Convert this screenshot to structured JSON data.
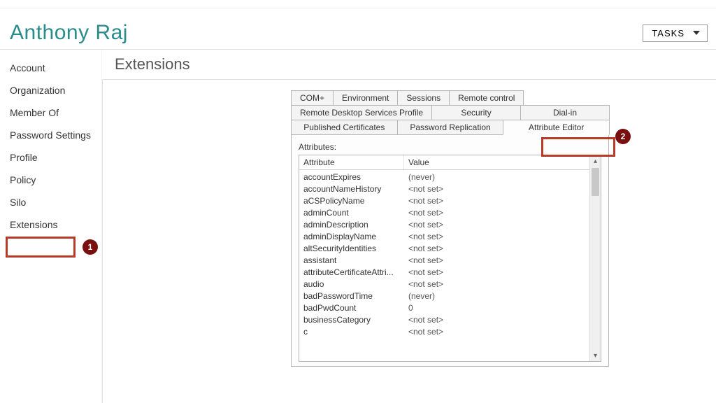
{
  "header": {
    "title": "Anthony Raj",
    "tasks_label": "TASKS"
  },
  "sidebar": {
    "items": [
      {
        "label": "Account"
      },
      {
        "label": "Organization"
      },
      {
        "label": "Member Of"
      },
      {
        "label": "Password Settings"
      },
      {
        "label": "Profile"
      },
      {
        "label": "Policy"
      },
      {
        "label": "Silo"
      },
      {
        "label": "Extensions"
      }
    ],
    "active_index": 7
  },
  "content": {
    "section_title": "Extensions"
  },
  "prop_sheet": {
    "tab_rows": [
      [
        {
          "label": "COM+"
        },
        {
          "label": "Environment"
        },
        {
          "label": "Sessions"
        },
        {
          "label": "Remote control"
        }
      ],
      [
        {
          "label": "Remote Desktop Services Profile"
        },
        {
          "label": "Security"
        },
        {
          "label": "Dial-in"
        }
      ],
      [
        {
          "label": "Published Certificates"
        },
        {
          "label": "Password Replication"
        },
        {
          "label": "Attribute Editor",
          "active": true
        }
      ]
    ],
    "attrs_label": "Attributes:",
    "columns": {
      "attr": "Attribute",
      "val": "Value"
    },
    "rows": [
      {
        "attr": "accountExpires",
        "val": "(never)"
      },
      {
        "attr": "accountNameHistory",
        "val": "<not set>"
      },
      {
        "attr": "aCSPolicyName",
        "val": "<not set>"
      },
      {
        "attr": "adminCount",
        "val": "<not set>"
      },
      {
        "attr": "adminDescription",
        "val": "<not set>"
      },
      {
        "attr": "adminDisplayName",
        "val": "<not set>"
      },
      {
        "attr": "altSecurityIdentities",
        "val": "<not set>"
      },
      {
        "attr": "assistant",
        "val": "<not set>"
      },
      {
        "attr": "attributeCertificateAttri...",
        "val": "<not set>"
      },
      {
        "attr": "audio",
        "val": "<not set>"
      },
      {
        "attr": "badPasswordTime",
        "val": "(never)"
      },
      {
        "attr": "badPwdCount",
        "val": "0"
      },
      {
        "attr": "businessCategory",
        "val": "<not set>"
      },
      {
        "attr": "c",
        "val": "<not set>"
      }
    ]
  },
  "callouts": {
    "b1": "1",
    "b2": "2"
  }
}
